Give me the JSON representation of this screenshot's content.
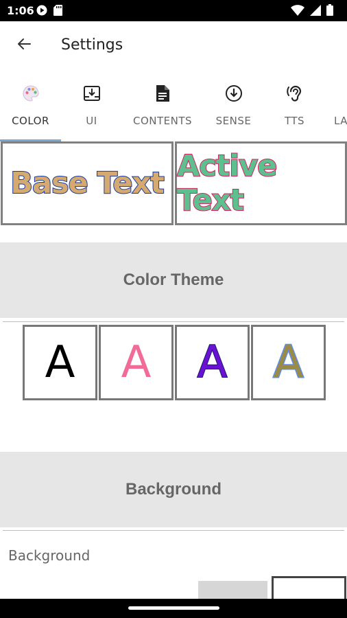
{
  "status_bar": {
    "time": "1:06",
    "left_icons": [
      "play-notification-icon",
      "sd-card-icon"
    ],
    "right_icons": [
      "wifi-icon",
      "signal-icon",
      "battery-icon"
    ]
  },
  "app_bar": {
    "title": "Settings",
    "back_icon": "arrow-back-icon"
  },
  "tabs": [
    {
      "label": "COLOR",
      "icon": "palette-icon",
      "active": true
    },
    {
      "label": "UI",
      "icon": "download-box-icon",
      "active": false
    },
    {
      "label": "CONTENTS",
      "icon": "document-icon",
      "active": false
    },
    {
      "label": "SENSE",
      "icon": "circle-arrow-down-icon",
      "active": false
    },
    {
      "label": "TTS",
      "icon": "ear-icon",
      "active": false
    },
    {
      "label": "LA",
      "icon": "",
      "active": false
    }
  ],
  "preview": {
    "base_text": "Base Text",
    "active_text": "Active Text",
    "base_fill": "#d4aa70",
    "base_outline": "#1838a0",
    "active_fill": "#5ec08e",
    "active_outline": "#d0215f"
  },
  "sections": {
    "color_theme": "Color Theme",
    "background": "Background"
  },
  "themes": [
    {
      "letter": "A",
      "fill": "#000000",
      "outline": "none"
    },
    {
      "letter": "A",
      "fill": "#f06b98",
      "outline": "none"
    },
    {
      "letter": "A",
      "fill": "#6a12d4",
      "outline": "#1a1a6a"
    },
    {
      "letter": "A",
      "fill": "#9c8a48",
      "outline": "#5a8fe8"
    }
  ],
  "background": {
    "label": "Background"
  }
}
